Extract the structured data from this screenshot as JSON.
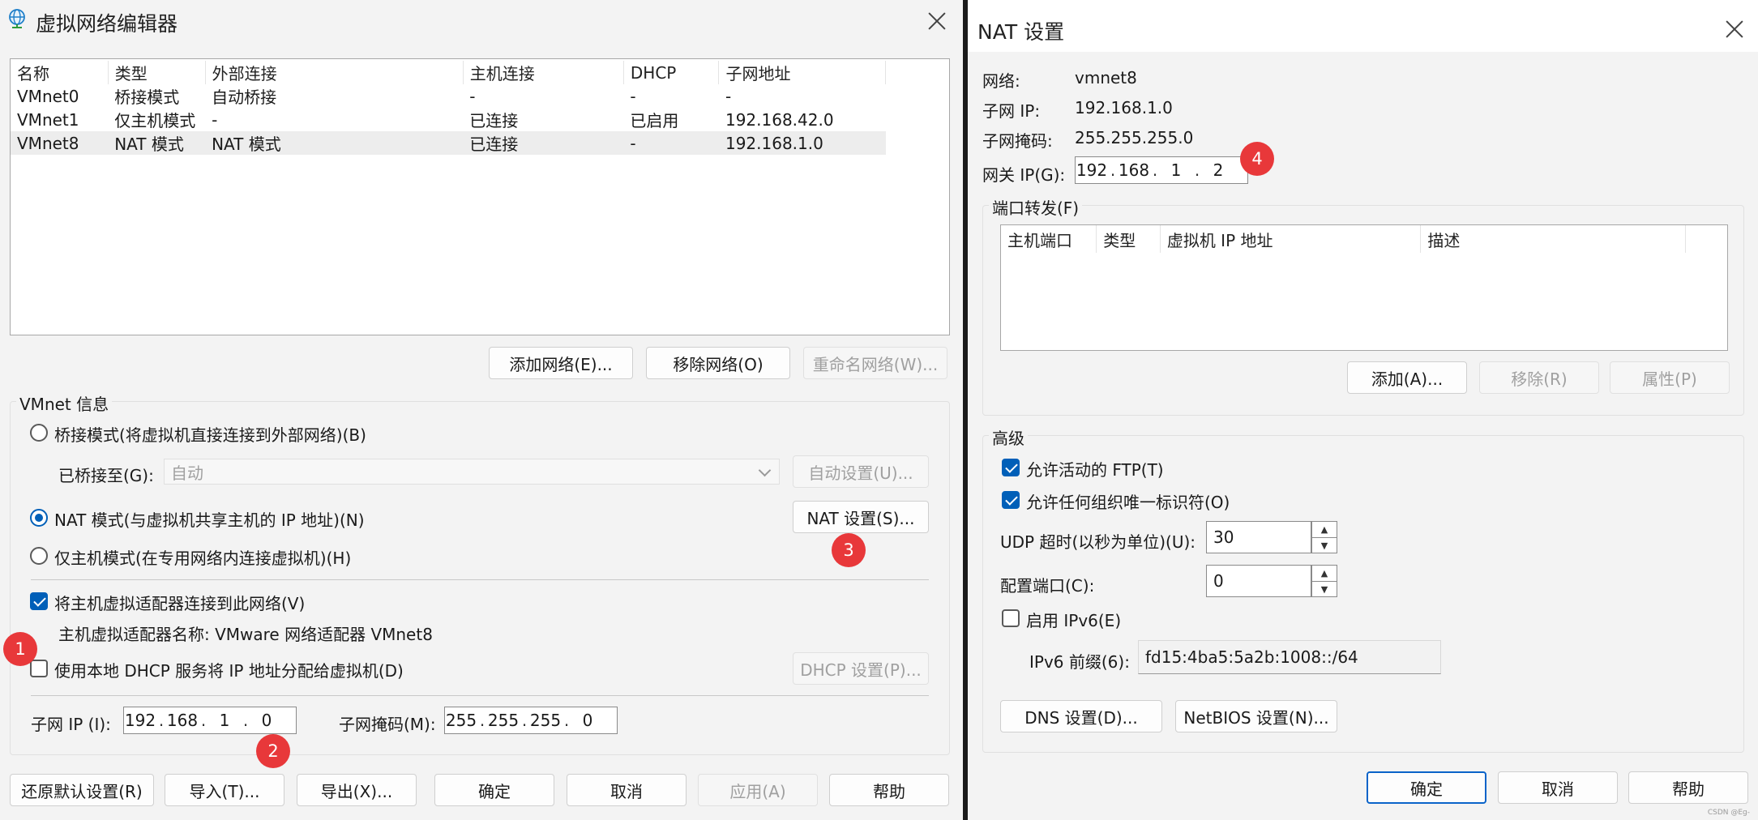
{
  "vne": {
    "title": "虚拟网络编辑器",
    "table": {
      "headers": [
        "名称",
        "类型",
        "外部连接",
        "主机连接",
        "DHCP",
        "子网地址"
      ],
      "rows": [
        [
          "VMnet0",
          "桥接模式",
          "自动桥接",
          "-",
          "-",
          "-"
        ],
        [
          "VMnet1",
          "仅主机模式",
          "-",
          "已连接",
          "已启用",
          "192.168.42.0"
        ],
        [
          "VMnet8",
          "NAT 模式",
          "NAT 模式",
          "已连接",
          "-",
          "192.168.1.0"
        ]
      ]
    },
    "buttons": {
      "add_network": "添加网络(E)...",
      "remove_network": "移除网络(O)",
      "rename_network": "重命名网络(W)...",
      "auto_settings": "自动设置(U)...",
      "nat_settings": "NAT 设置(S)...",
      "dhcp_settings": "DHCP 设置(P)...",
      "restore_defaults": "还原默认设置(R)",
      "import": "导入(T)...",
      "export": "导出(X)...",
      "ok": "确定",
      "cancel": "取消",
      "apply": "应用(A)",
      "help": "帮助"
    },
    "info": {
      "group_label": "VMnet 信息",
      "bridged": "桥接模式(将虚拟机直接连接到外部网络)(B)",
      "bridged_to_label": "已桥接至(G):",
      "bridged_to_value": "自动",
      "nat": "NAT 模式(与虚拟机共享主机的 IP 地址)(N)",
      "host_only": "仅主机模式(在专用网络内连接虚拟机)(H)",
      "connect_adapter": "将主机虚拟适配器连接到此网络(V)",
      "adapter_name": "主机虚拟适配器名称: VMware 网络适配器 VMnet8",
      "use_dhcp": "使用本地 DHCP 服务将 IP 地址分配给虚拟机(D)",
      "subnet_ip_label": "子网 IP (I):",
      "subnet_ip": [
        "192",
        "168",
        "1",
        "0"
      ],
      "subnet_mask_label": "子网掩码(M):",
      "subnet_mask": [
        "255",
        "255",
        "255",
        "0"
      ]
    },
    "badges": [
      "1",
      "2",
      "3"
    ]
  },
  "nat": {
    "title": "NAT 设置",
    "network_label": "网络:",
    "network_value": "vmnet8",
    "subnet_ip_label": "子网 IP:",
    "subnet_ip_value": "192.168.1.0",
    "subnet_mask_label": "子网掩码:",
    "subnet_mask_value": "255.255.255.0",
    "gateway_label": "网关 IP(G):",
    "gateway": [
      "192",
      "168",
      "1",
      "2"
    ],
    "badge": "4",
    "port_forwarding_label": "端口转发(F)",
    "port_headers": [
      "主机端口",
      "类型",
      "虚拟机 IP 地址",
      "描述"
    ],
    "add_button": "添加(A)...",
    "remove_button": "移除(R)",
    "properties_button": "属性(P)",
    "advanced_label": "高级",
    "allow_ftp": "允许活动的 FTP(T)",
    "allow_oui": "允许任何组织唯一标识符(O)",
    "udp_timeout_label": "UDP 超时(以秒为单位)(U):",
    "udp_timeout_value": "30",
    "config_port_label": "配置端口(C):",
    "config_port_value": "0",
    "enable_ipv6": "启用 IPv6(E)",
    "ipv6_prefix_label": "IPv6 前缀(6):",
    "ipv6_prefix_value": "fd15:4ba5:5a2b:1008::/64",
    "dns_button": "DNS 设置(D)...",
    "netbios_button": "NetBIOS 设置(N)...",
    "ok_button": "确定",
    "cancel_button": "取消",
    "help_button": "帮助",
    "watermark": "CSDN @Eg-"
  },
  "colors": {
    "accent": "#005fb8",
    "badge": "#e8383a",
    "window_bg": "#f3f3f3"
  }
}
